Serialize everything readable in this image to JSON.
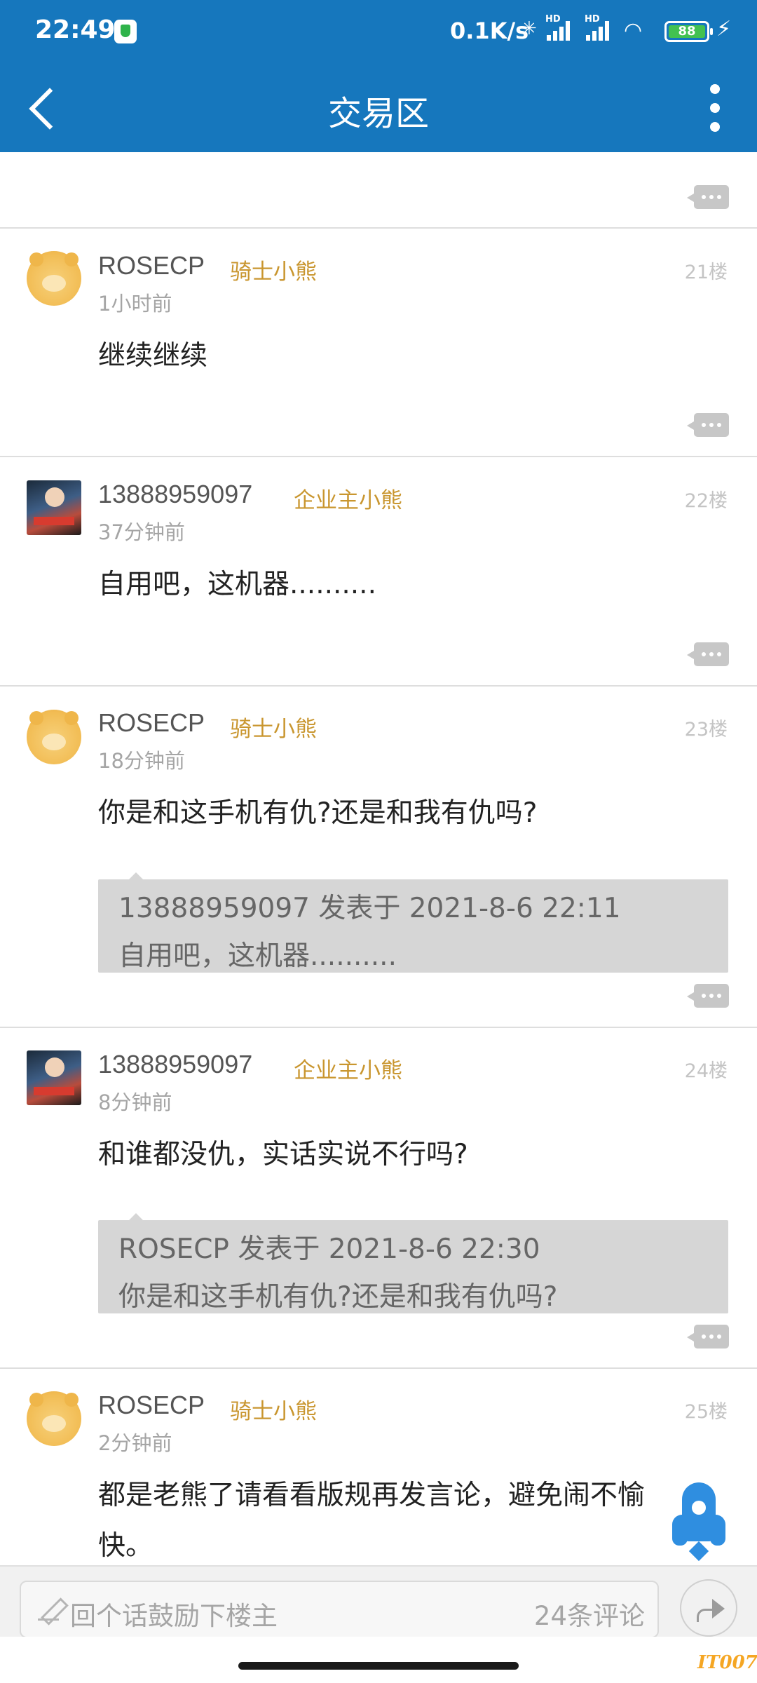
{
  "statusbar": {
    "time": "22:49",
    "net_speed": "0.1K/s",
    "hd1": "HD",
    "hd2": "HD",
    "battery": "88"
  },
  "header": {
    "title": "交易区"
  },
  "posts": [
    {
      "username": "ROSECP",
      "badge": "骑士小熊",
      "floor": "21楼",
      "time": "1小时前",
      "content": "继续继续",
      "avatar": "bear-avatar"
    },
    {
      "username": "13888959097",
      "badge": "企业主小熊",
      "floor": "22楼",
      "time": "37分钟前",
      "content": "自用吧，这机器..........",
      "avatar": "photo-avatar"
    },
    {
      "username": "ROSECP",
      "badge": "骑士小熊",
      "floor": "23楼",
      "time": "18分钟前",
      "content": "你是和这手机有仇?还是和我有仇吗?",
      "avatar": "bear-avatar",
      "quote": {
        "line1": "13888959097 发表于 2021-8-6 22:11",
        "line2": "自用吧，这机器.........."
      }
    },
    {
      "username": "13888959097",
      "badge": "企业主小熊",
      "floor": "24楼",
      "time": "8分钟前",
      "content": "和谁都没仇，实话实说不行吗?",
      "avatar": "photo-avatar",
      "quote": {
        "line1": "ROSECP 发表于 2021-8-6 22:30",
        "line2": "你是和这手机有仇?还是和我有仇吗?"
      }
    },
    {
      "username": "ROSECP",
      "badge": "骑士小熊",
      "floor": "25楼",
      "time": "2分钟前",
      "content": "都是老熊了请看看版规再发言论，避免闹不愉快。",
      "avatar": "bear-avatar"
    }
  ],
  "reply": {
    "placeholder": "回个话鼓励下楼主",
    "count": "24条评论"
  },
  "watermark": "IT007",
  "colors": {
    "header_bg": "#1677bd",
    "badge": "#c9962f",
    "accent": "#2f8ee0"
  }
}
